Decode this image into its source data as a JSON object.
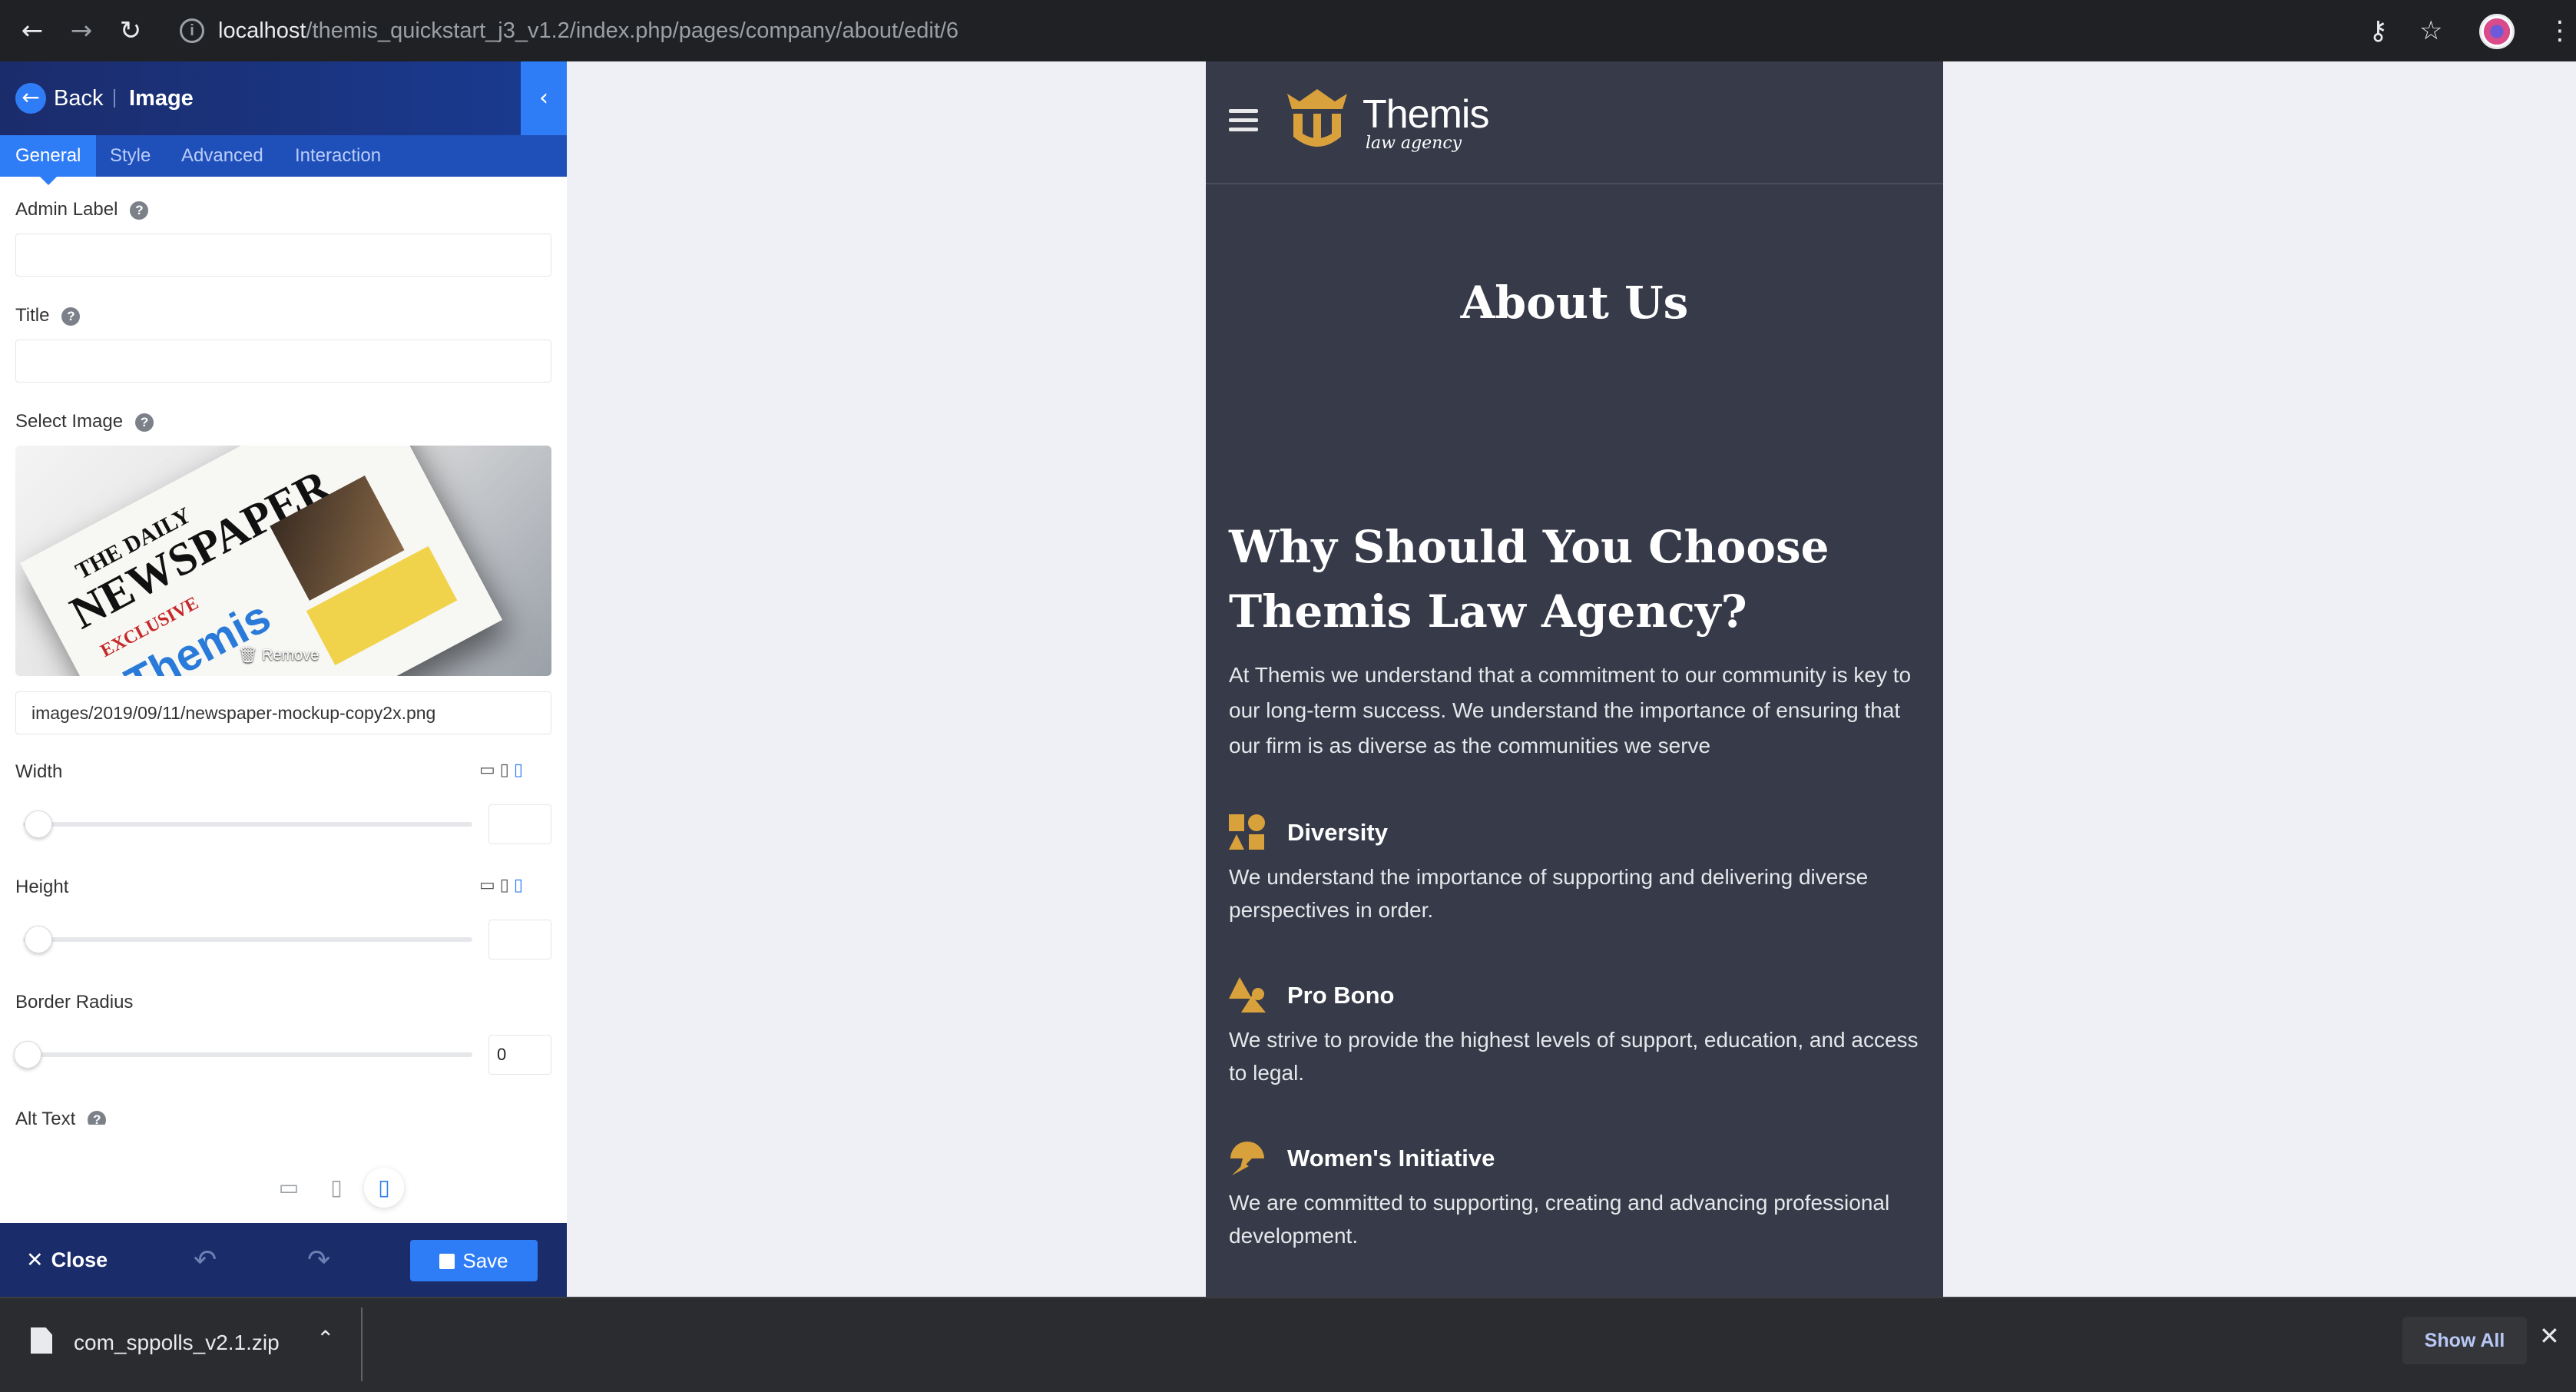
{
  "browser": {
    "url_host": "localhost",
    "url_path": "/themis_quickstart_j3_v1.2/index.php/pages/company/about/edit/6"
  },
  "editor": {
    "back_label": "Back",
    "title": "Image",
    "tabs": [
      "General",
      "Style",
      "Advanced",
      "Interaction"
    ],
    "fields": {
      "admin_label": "Admin Label",
      "title": "Title",
      "select_image": "Select Image",
      "image_path": "images/2019/09/11/newspaper-mockup-copy2x.png",
      "remove_label": "Remove",
      "width": "Width",
      "height": "Height",
      "border_radius": "Border Radius",
      "border_radius_value": "0",
      "alt_text": "Alt Text"
    },
    "thumbnail": {
      "headline": "NEWSPAPER",
      "masthead": "THE DAILY",
      "tag": "EXCLUSIVE",
      "brand": "Themis"
    },
    "footer": {
      "close_label": "Close",
      "save_label": "Save"
    },
    "accent": "#2f7df6"
  },
  "site": {
    "logo_name": "Themis",
    "logo_tagline": "law agency",
    "page_title": "About Us",
    "section_title": "Why Should You Choose Themis Law Agency?",
    "intro": "At Themis we understand that a commitment to our community is key to our long-term success. We understand the importance of ensuring that our firm is as diverse as the communities we serve",
    "accent": "#d9a13c",
    "features": [
      {
        "title": "Diversity",
        "text": "We understand the importance of supporting and delivering diverse perspectives in order."
      },
      {
        "title": "Pro Bono",
        "text": "We strive to provide the highest levels of support, education, and access to legal."
      },
      {
        "title": "Women's Initiative",
        "text": "We are committed to supporting, creating and advancing professional development."
      }
    ]
  },
  "downloads": {
    "file_name": "com_sppolls_v2.1.zip",
    "show_all": "Show All"
  }
}
